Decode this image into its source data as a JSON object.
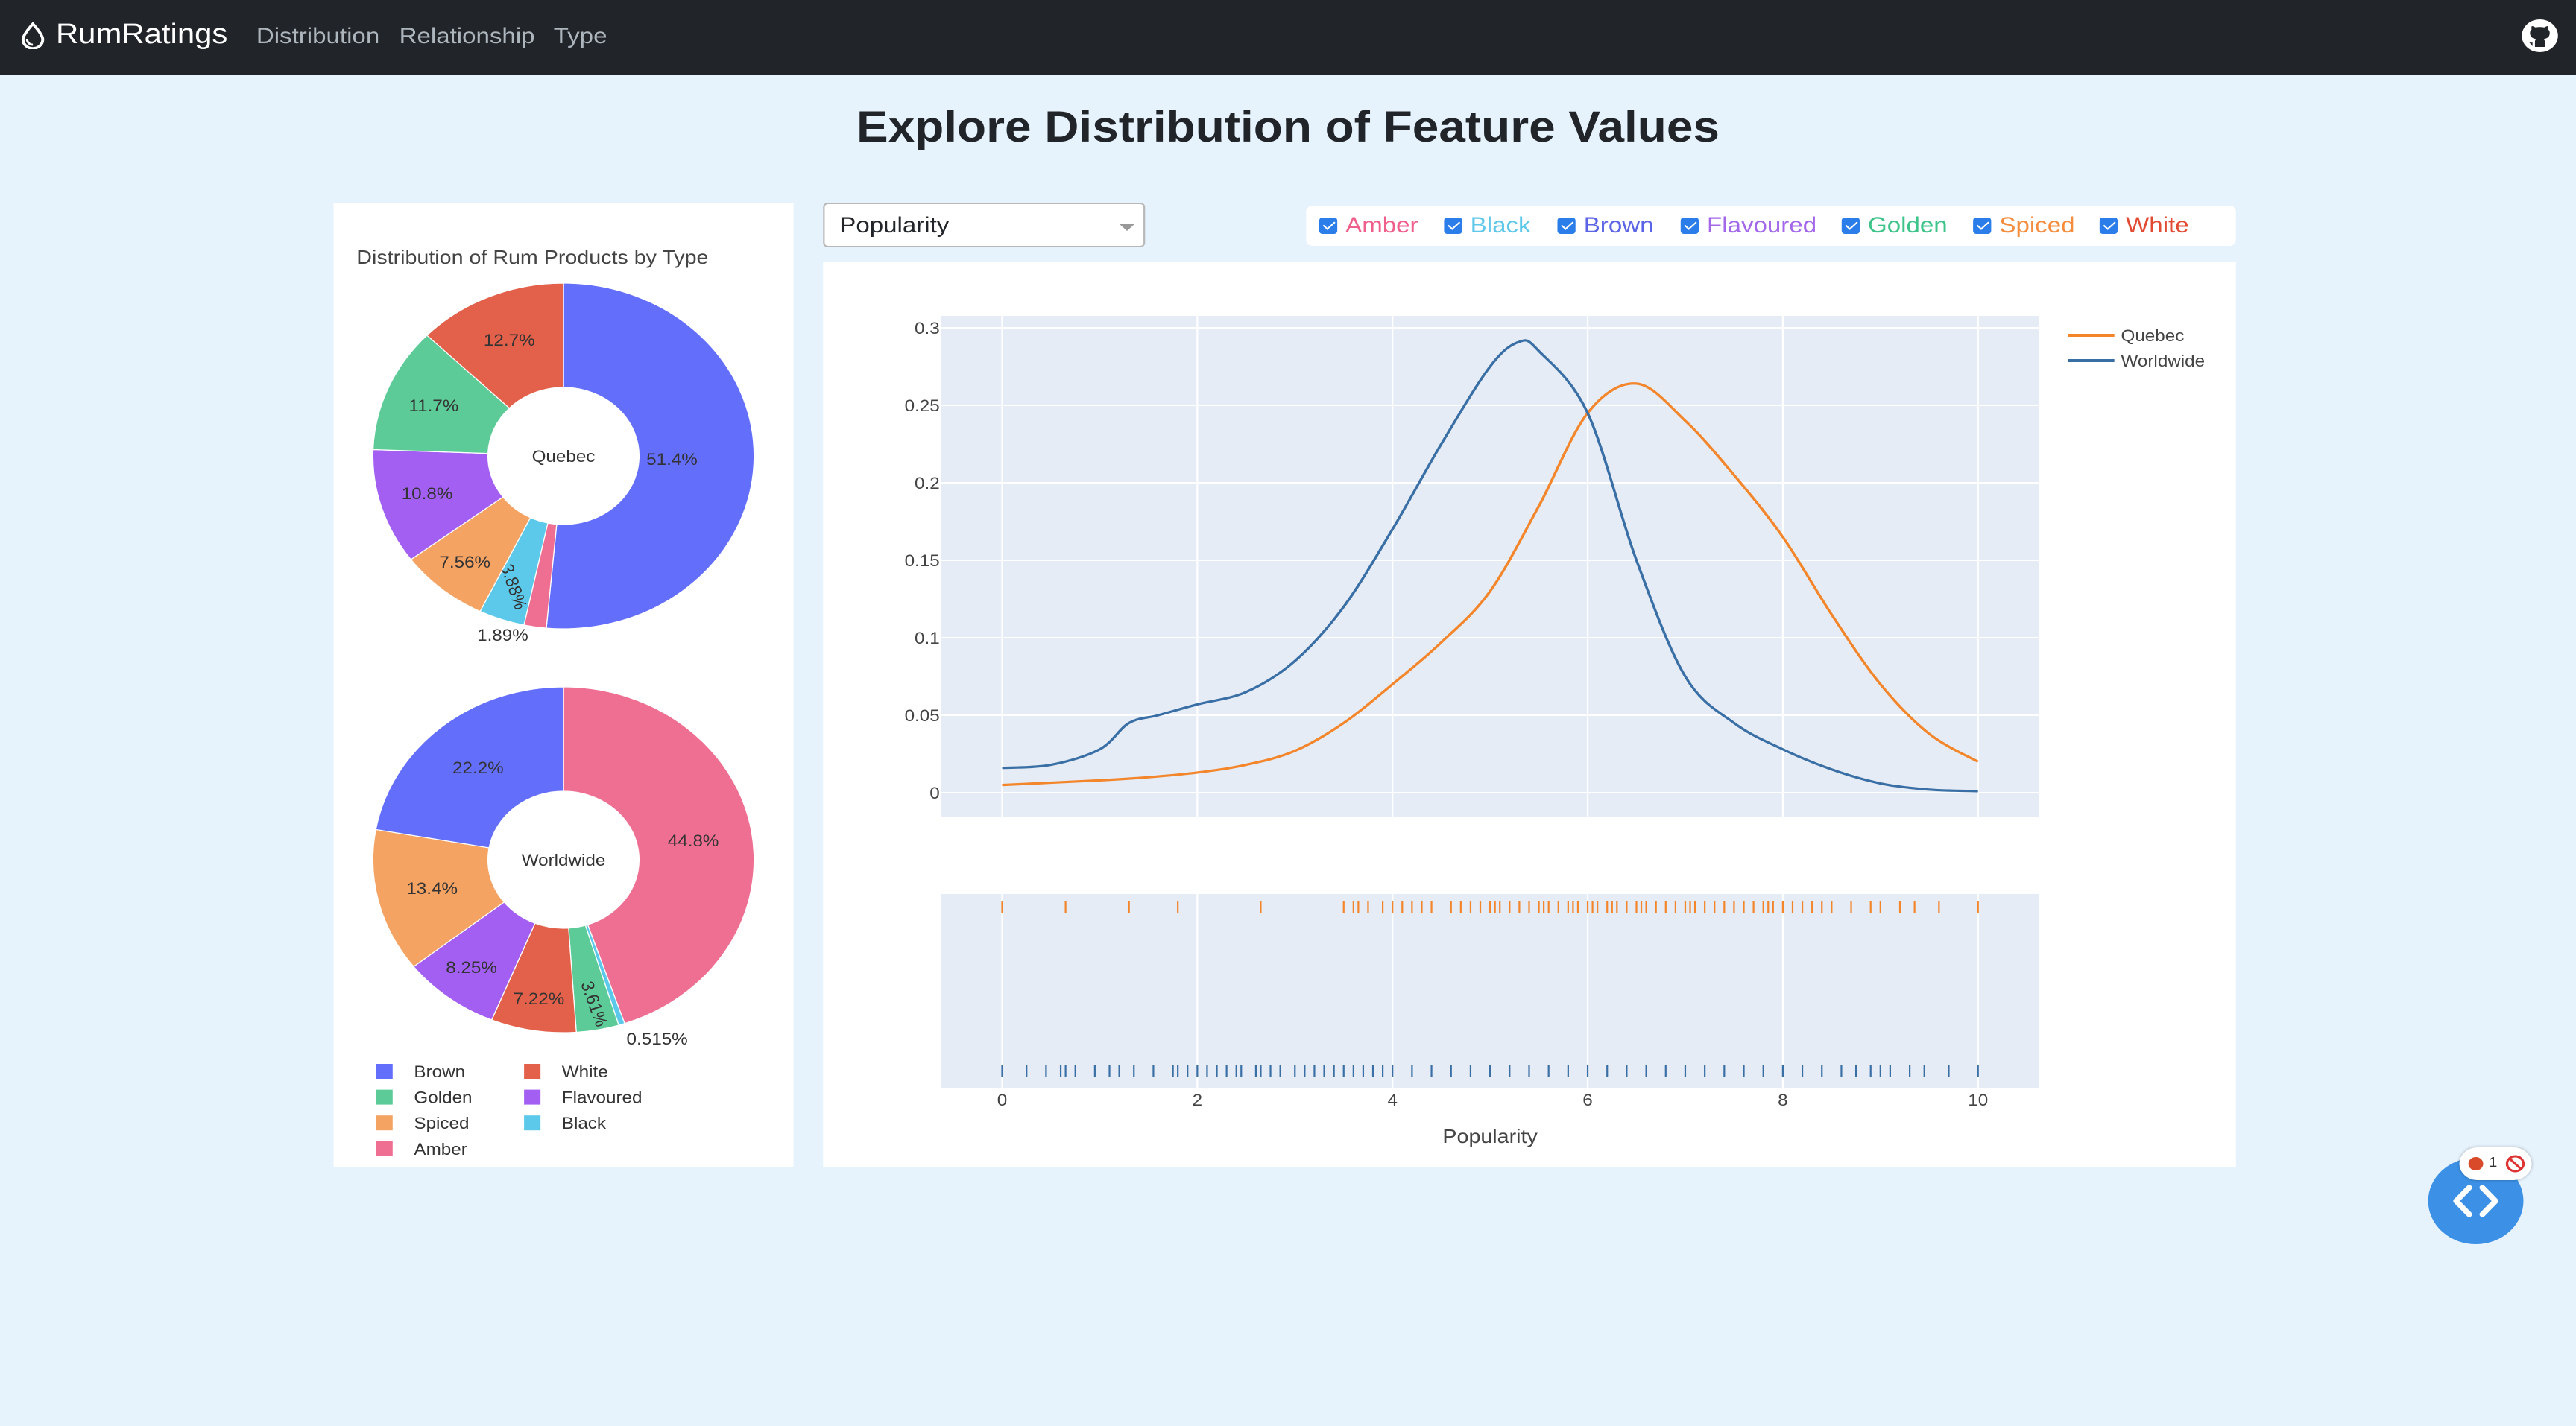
{
  "nav": {
    "brand": "RumRatings",
    "links": [
      "Distribution",
      "Relationship",
      "Type"
    ]
  },
  "page_title": "Explore Distribution of Feature Values",
  "feature_select": {
    "value": "Popularity"
  },
  "type_filters": [
    {
      "label": "Amber",
      "color": "#ef5f8b",
      "checked": true
    },
    {
      "label": "Black",
      "color": "#5fc8ea",
      "checked": true
    },
    {
      "label": "Brown",
      "color": "#5b63e6",
      "checked": true
    },
    {
      "label": "Flavoured",
      "color": "#a367e9",
      "checked": true
    },
    {
      "label": "Golden",
      "color": "#3ec48a",
      "checked": true
    },
    {
      "label": "Spiced",
      "color": "#f58d3e",
      "checked": true
    },
    {
      "label": "White",
      "color": "#e14b33",
      "checked": true
    }
  ],
  "badge": {
    "count": "1"
  },
  "chart_data": [
    {
      "type": "pie",
      "title": "Distribution of Rum Products by Type",
      "center_label": "Quebec",
      "slices": [
        {
          "label": "Brown",
          "value": 51.4,
          "text": "51.4%",
          "color": "#636efa"
        },
        {
          "label": "Amber",
          "value": 1.89,
          "text": "1.89%",
          "color": "#ef6f92"
        },
        {
          "label": "Black",
          "value": 3.88,
          "text": "3.88%",
          "color": "#5cc9ea"
        },
        {
          "label": "Spiced",
          "value": 7.56,
          "text": "7.56%",
          "color": "#f4a363"
        },
        {
          "label": "Flavoured",
          "value": 10.8,
          "text": "10.8%",
          "color": "#a25ff2"
        },
        {
          "label": "Golden",
          "value": 11.7,
          "text": "11.7%",
          "color": "#5ccb98"
        },
        {
          "label": "White",
          "value": 12.7,
          "text": "12.7%",
          "color": "#e3614a"
        }
      ]
    },
    {
      "type": "pie",
      "center_label": "Worldwide",
      "slices": [
        {
          "label": "Amber",
          "value": 44.8,
          "text": "44.8%",
          "color": "#ef6f92"
        },
        {
          "label": "Black",
          "value": 0.515,
          "text": "0.515%",
          "color": "#5cc9ea"
        },
        {
          "label": "Golden",
          "value": 3.61,
          "text": "3.61%",
          "color": "#5ccb98"
        },
        {
          "label": "White",
          "value": 7.22,
          "text": "7.22%",
          "color": "#e3614a"
        },
        {
          "label": "Flavoured",
          "value": 8.25,
          "text": "8.25%",
          "color": "#a25ff2"
        },
        {
          "label": "Spiced",
          "value": 13.4,
          "text": "13.4%",
          "color": "#f4a363"
        },
        {
          "label": "Brown",
          "value": 22.2,
          "text": "22.2%",
          "color": "#636efa"
        }
      ]
    },
    {
      "type": "line",
      "xlabel": "Popularity",
      "ylabel": "",
      "xlim": [
        0,
        10
      ],
      "ylim": [
        0,
        0.3
      ],
      "xticks": [
        "0",
        "2",
        "4",
        "6",
        "8",
        "10"
      ],
      "yticks": [
        "0",
        "0.05",
        "0.1",
        "0.15",
        "0.2",
        "0.25",
        "0.3"
      ],
      "legend": "top-right",
      "series": [
        {
          "name": "Quebec",
          "color": "#f3852a",
          "x": [
            0,
            1,
            1.5,
            2,
            2.5,
            3,
            3.5,
            4,
            4.5,
            5,
            5.5,
            6,
            6.5,
            7,
            7.5,
            8,
            8.5,
            9,
            9.5,
            10
          ],
          "y": [
            0.005,
            0.008,
            0.01,
            0.013,
            0.018,
            0.027,
            0.045,
            0.07,
            0.097,
            0.13,
            0.185,
            0.245,
            0.264,
            0.24,
            0.205,
            0.165,
            0.115,
            0.07,
            0.038,
            0.02
          ]
        },
        {
          "name": "Worldwide",
          "color": "#3a6fa6",
          "x": [
            0,
            0.5,
            1,
            1.3,
            1.6,
            2,
            2.5,
            3,
            3.5,
            4,
            4.5,
            5,
            5.3,
            5.5,
            6,
            6.5,
            7,
            7.5,
            8,
            8.5,
            9,
            9.5,
            10
          ],
          "y": [
            0.016,
            0.018,
            0.028,
            0.045,
            0.05,
            0.057,
            0.065,
            0.085,
            0.12,
            0.17,
            0.225,
            0.275,
            0.291,
            0.285,
            0.245,
            0.15,
            0.075,
            0.045,
            0.028,
            0.015,
            0.006,
            0.002,
            0.001
          ]
        }
      ],
      "rug": {
        "Quebec": [
          0,
          0.65,
          1.3,
          1.8,
          2.65,
          3.5,
          3.6,
          3.65,
          3.75,
          3.9,
          4,
          4.1,
          4.2,
          4.3,
          4.4,
          4.6,
          4.7,
          4.8,
          4.9,
          5,
          5.05,
          5.1,
          5.2,
          5.3,
          5.4,
          5.5,
          5.55,
          5.6,
          5.7,
          5.8,
          5.85,
          5.9,
          6,
          6.05,
          6.1,
          6.2,
          6.25,
          6.3,
          6.4,
          6.5,
          6.55,
          6.6,
          6.7,
          6.8,
          6.9,
          7,
          7.05,
          7.1,
          7.2,
          7.3,
          7.4,
          7.5,
          7.6,
          7.7,
          7.8,
          7.85,
          7.9,
          8,
          8.1,
          8.2,
          8.3,
          8.4,
          8.5,
          8.7,
          8.9,
          9,
          9.2,
          9.35,
          9.6,
          10
        ],
        "Worldwide": [
          0,
          0.25,
          0.45,
          0.6,
          0.65,
          0.75,
          0.95,
          1.1,
          1.2,
          1.35,
          1.55,
          1.75,
          1.8,
          1.9,
          2,
          2.1,
          2.2,
          2.3,
          2.4,
          2.45,
          2.6,
          2.65,
          2.75,
          2.85,
          3,
          3.1,
          3.2,
          3.3,
          3.4,
          3.5,
          3.6,
          3.7,
          3.8,
          3.9,
          4,
          4.2,
          4.4,
          4.6,
          4.8,
          5,
          5.2,
          5.4,
          5.6,
          5.8,
          6,
          6.2,
          6.4,
          6.6,
          6.8,
          7,
          7.2,
          7.4,
          7.6,
          7.8,
          8,
          8.2,
          8.4,
          8.6,
          8.75,
          8.9,
          9,
          9.1,
          9.3,
          9.45,
          9.7,
          10
        ]
      }
    }
  ]
}
